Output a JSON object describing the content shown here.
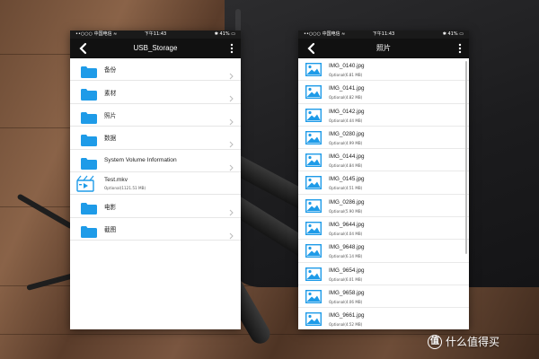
{
  "colors": {
    "folder_blue": "#1e9be8",
    "nav_bg": "#111111",
    "status_bg": "#1a1a1a",
    "video_icon": "#1e9be8"
  },
  "left_phone": {
    "status": {
      "carrier": "••○○○ 中国电信 ≈",
      "time": "下午11:43",
      "battery": "✱ 41% ▭"
    },
    "title": "USB_Storage",
    "items": [
      {
        "type": "folder",
        "label": "备份",
        "icon": "folder-icon"
      },
      {
        "type": "folder",
        "label": "素材",
        "icon": "folder-icon"
      },
      {
        "type": "folder",
        "label": "照片",
        "icon": "folder-icon"
      },
      {
        "type": "folder",
        "label": "数据",
        "icon": "folder-icon"
      },
      {
        "type": "folder",
        "label": "System Volume Information",
        "icon": "folder-icon"
      },
      {
        "type": "file",
        "label": "Test.mkv",
        "sub": "Optional(1121.51 MB)",
        "icon": "video-icon"
      },
      {
        "type": "folder",
        "label": "电影",
        "icon": "folder-icon"
      },
      {
        "type": "folder",
        "label": "截图",
        "icon": "folder-icon"
      }
    ]
  },
  "right_phone": {
    "status": {
      "carrier": "••○○○ 中国电信 ≈",
      "time": "下午11:43",
      "battery": "✱ 41% ▭"
    },
    "title": "照片",
    "items": [
      {
        "name": "IMG_0140.jpg",
        "size": "Optional(6.81 MB)"
      },
      {
        "name": "IMG_0141.jpg",
        "size": "Optional(4.82 MB)"
      },
      {
        "name": "IMG_0142.jpg",
        "size": "Optional(4.44 MB)"
      },
      {
        "name": "IMG_0280.jpg",
        "size": "Optional(4.99 MB)"
      },
      {
        "name": "IMG_0144.jpg",
        "size": "Optional(4.84 MB)"
      },
      {
        "name": "IMG_0145.jpg",
        "size": "Optional(4.51 MB)"
      },
      {
        "name": "IMG_0286.jpg",
        "size": "Optional(5.90 MB)"
      },
      {
        "name": "IMG_9644.jpg",
        "size": "Optional(4.04 MB)"
      },
      {
        "name": "IMG_9648.jpg",
        "size": "Optional(6.14 MB)"
      },
      {
        "name": "IMG_9654.jpg",
        "size": "Optional(6.01 MB)"
      },
      {
        "name": "IMG_9658.jpg",
        "size": "Optional(4.06 MB)"
      },
      {
        "name": "IMG_9661.jpg",
        "size": "Optional(4.52 MB)"
      }
    ]
  },
  "watermark": {
    "text": "什么值得买",
    "logo": "值"
  }
}
